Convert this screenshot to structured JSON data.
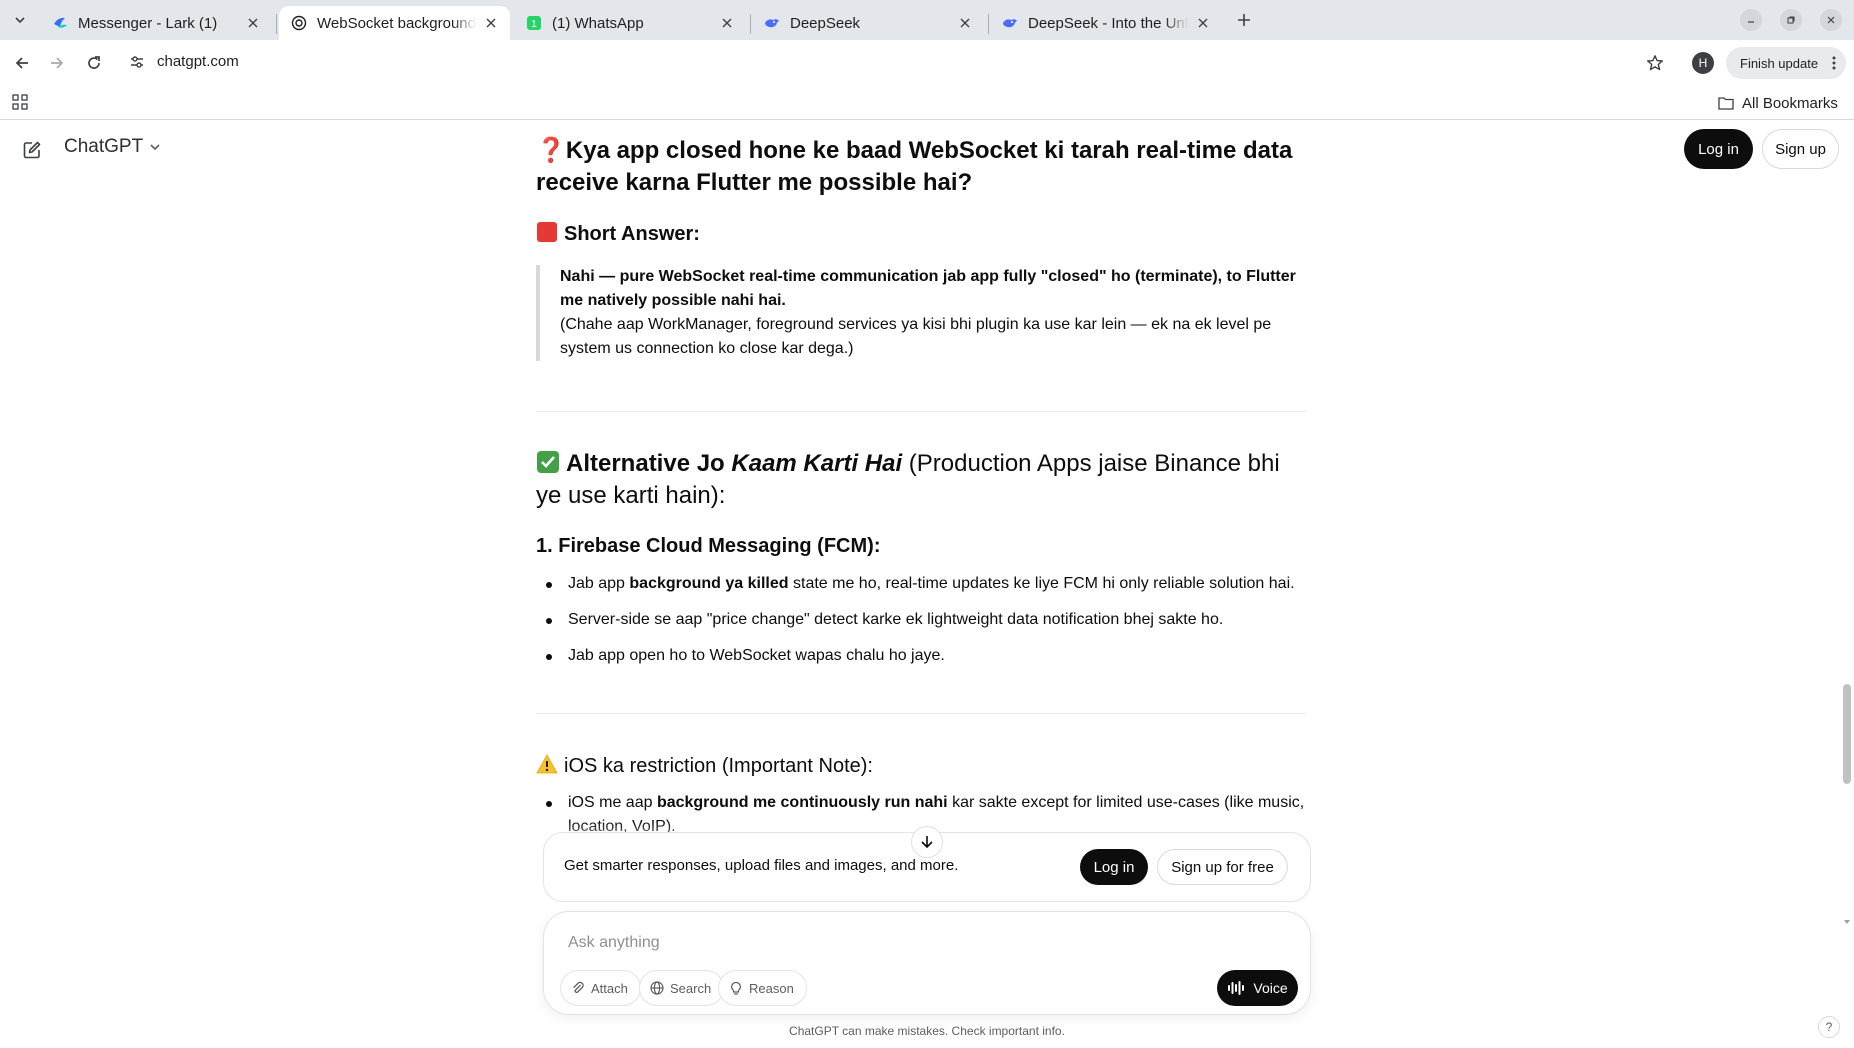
{
  "browser": {
    "tabs": [
      {
        "title": "Messenger - Lark (1)",
        "active": false
      },
      {
        "title": "WebSocket background fetch",
        "active": true
      },
      {
        "title": "(1) WhatsApp",
        "active": false
      },
      {
        "title": "DeepSeek",
        "active": false
      },
      {
        "title": "DeepSeek - Into the Unknown",
        "active": false
      }
    ],
    "url": "chatgpt.com",
    "profile_initial": "H",
    "finish_update_label": "Finish update",
    "all_bookmarks_label": "All Bookmarks"
  },
  "chatgpt": {
    "brand": "ChatGPT",
    "login_label": "Log in",
    "signup_label": "Sign up"
  },
  "article": {
    "heading1_emoji": "❓",
    "heading1": "Kya app closed hone ke baad WebSocket ki tarah real-time data receive karna Flutter me possible hai?",
    "short_answer_emoji": "🟥",
    "short_answer_heading": "Short Answer:",
    "quote_bold": "Nahi — pure WebSocket real-time communication jab app fully \"closed\" ho (terminate), to Flutter me natively possible nahi hai.",
    "quote_normal": "(Chahe aap WorkManager, foreground services ya kisi bhi plugin ka use kar lein — ek na ek level pe system us connection ko close kar dega.)",
    "heading2_emoji": "✅",
    "heading2_part1": "Alternative Jo ",
    "heading2_italic": "Kaam Karti Hai",
    "heading2_part2": " (Production Apps jaise Binance bhi ye use karti hain):",
    "section1_heading": "1. Firebase Cloud Messaging (FCM):",
    "section1_items": [
      {
        "pre": "Jab app ",
        "bold": "background ya killed",
        "post": " state me ho, real-time updates ke liye FCM hi only reliable solution hai."
      },
      {
        "pre": "Server-side se aap \"price change\" detect karke ek lightweight data notification bhej sakte ho.",
        "bold": "",
        "post": ""
      },
      {
        "pre": "Jab app open ho to WebSocket wapas chalu ho jaye.",
        "bold": "",
        "post": ""
      }
    ],
    "ios_emoji": "⚠️",
    "ios_heading": "iOS ka restriction (Important Note):",
    "ios_items": [
      {
        "pre": "iOS me aap ",
        "bold": "background me continuously run nahi",
        "post": " kar sakte except for limited use-cases (like music, location, VoIP)."
      }
    ]
  },
  "promo": {
    "text": "Get smarter responses, upload files and images, and more.",
    "login_label": "Log in",
    "signup_label": "Sign up for free"
  },
  "composer": {
    "placeholder": "Ask anything",
    "attach_label": "Attach",
    "search_label": "Search",
    "reason_label": "Reason",
    "voice_label": "Voice"
  },
  "disclaimer": "ChatGPT can make mistakes. Check important info.",
  "help_label": "?"
}
